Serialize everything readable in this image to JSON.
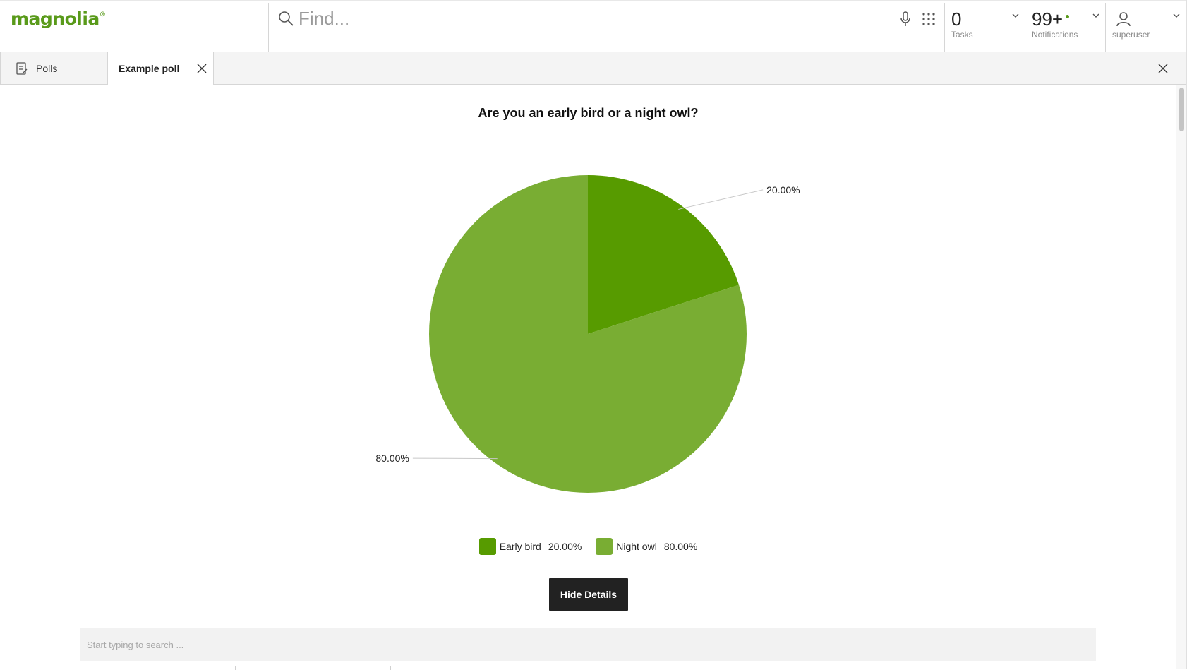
{
  "brand": {
    "logo_text": "magnolia",
    "logo_mark": "®",
    "accent_color": "#599a1a"
  },
  "search": {
    "placeholder": "Find...",
    "icons": [
      "search-icon",
      "microphone-icon",
      "apps-grid-icon"
    ]
  },
  "indicators": {
    "tasks": {
      "count": "0",
      "label": "Tasks"
    },
    "notifications": {
      "count": "99+",
      "label": "Notifications"
    },
    "user": {
      "name": "superuser"
    }
  },
  "tabs": [
    {
      "label": "Polls",
      "icon": "poll-list-icon",
      "active": false
    },
    {
      "label": "Example poll",
      "active": true,
      "closable": true
    }
  ],
  "chart_data": {
    "type": "pie",
    "title": "Are you an early bird or a night owl?",
    "categories": [
      "Early bird",
      "Night owl"
    ],
    "values": [
      20.0,
      80.0
    ],
    "labels": [
      "20.00%",
      "80.00%"
    ],
    "colors": [
      "#579b00",
      "#79ad33"
    ],
    "legend_position": "bottom"
  },
  "actions": {
    "hide_details_label": "Hide Details"
  },
  "table": {
    "search_placeholder": "Start typing to search ..."
  }
}
